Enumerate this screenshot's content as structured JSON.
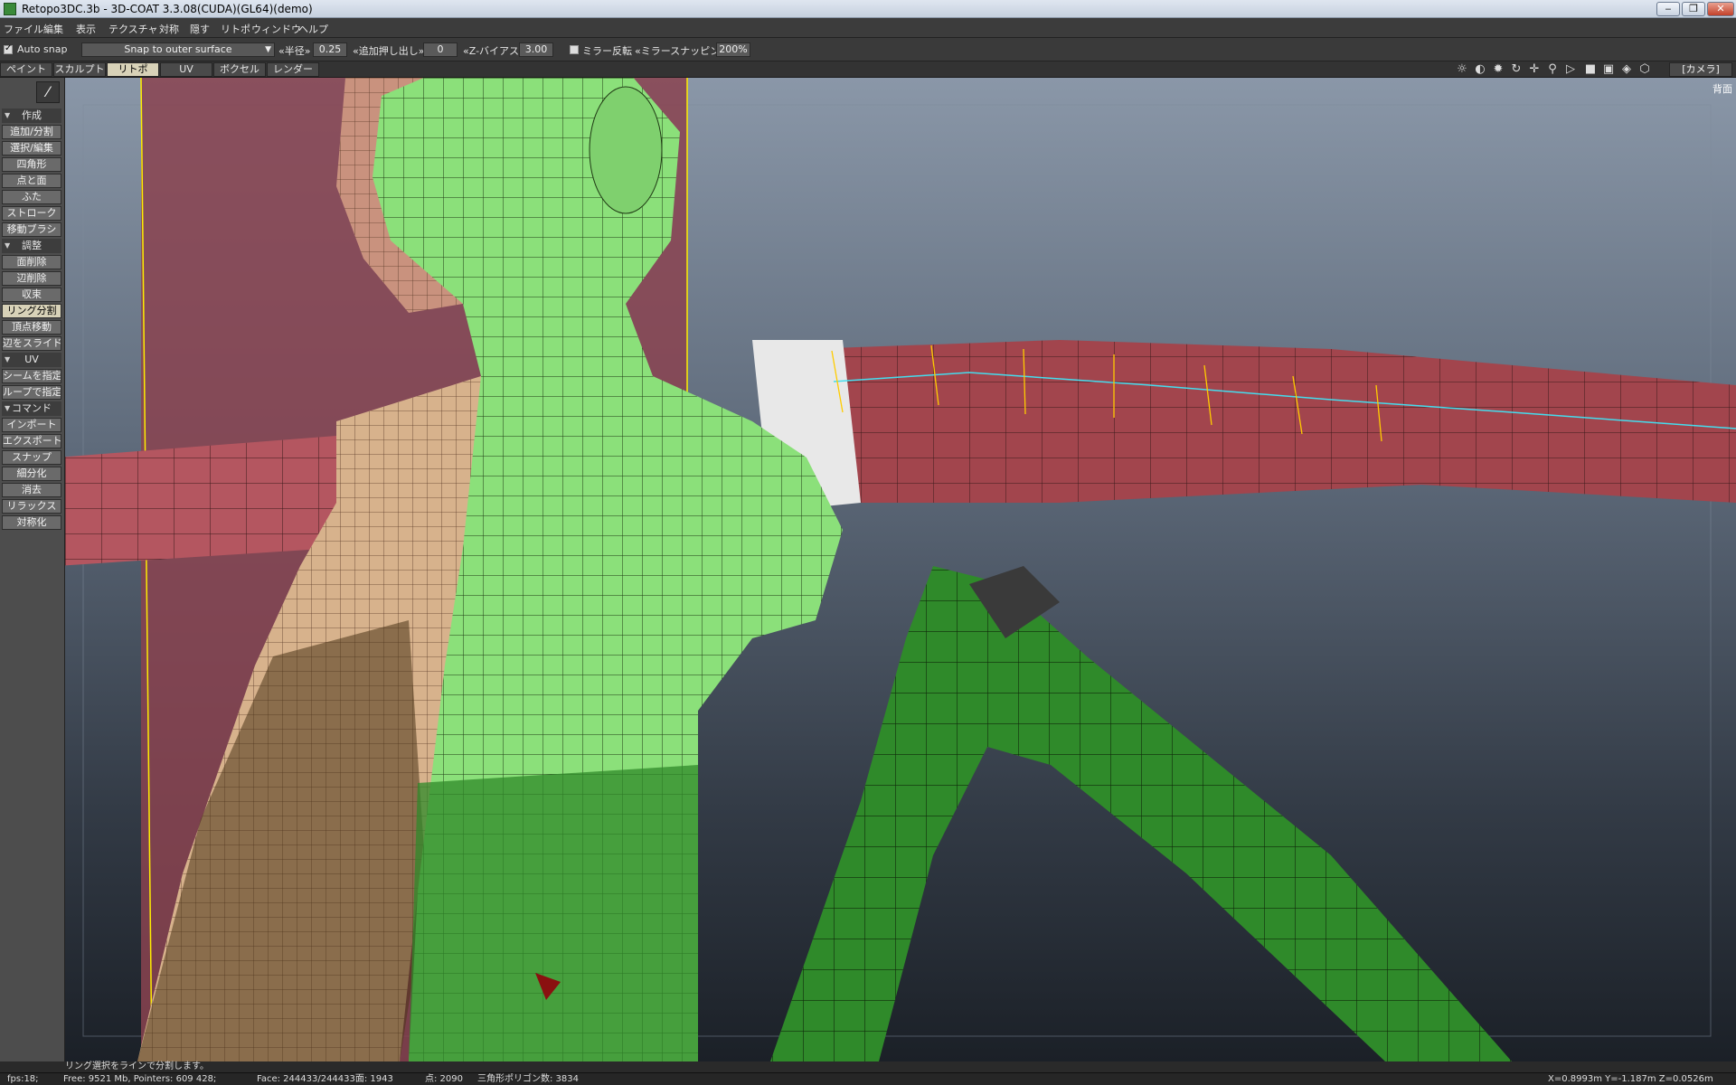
{
  "window": {
    "title": "Retopo3DC.3b - 3D-COAT 3.3.08(CUDA)(GL64)(demo)",
    "minimize": "‒",
    "maximize": "❐",
    "close": "✕"
  },
  "menu": [
    "ファイル",
    "編集",
    "表示",
    "テクスチャ",
    "対称",
    "隠す",
    "リトポ",
    "ウィンドウ",
    "ヘルプ"
  ],
  "toolbar": {
    "auto_snap_label": "Auto snap",
    "auto_snap_checked": true,
    "snap_mode": "Snap to outer surface",
    "radius_label": "«半径»",
    "radius_value": "0.25",
    "extrude_label": "«追加押し出し»",
    "extrude_value": "0",
    "zbias_label": "«Z-バイアス»",
    "zbias_value": "3.00",
    "mirror_label": "ミラー反転",
    "mirror_checked": false,
    "mirror_snap_label": "«ミラースナッピング»",
    "mirror_snap_value": "200%"
  },
  "rooms": {
    "tabs": [
      "ペイント",
      "スカルプト",
      "リトポ",
      "UV",
      "ボクセル",
      "レンダー"
    ],
    "active": "リトポ",
    "camera_label": "[カメラ]"
  },
  "viewport_icons": [
    "sun-icon",
    "contrast-icon",
    "light-icon",
    "rotate-icon",
    "move-icon",
    "zoom-icon",
    "play-icon",
    "square-icon",
    "frame-icon",
    "target-icon",
    "cube-icon"
  ],
  "panel": {
    "sections": [
      {
        "title": "作成",
        "items": [
          "追加/分割",
          "選択/編集",
          "四角形",
          "点と面",
          "ふた",
          "ストローク",
          "移動ブラシ"
        ]
      },
      {
        "title": "調整",
        "items": [
          "面削除",
          "辺削除",
          "収束",
          "リング分割",
          "頂点移動",
          "辺をスライド"
        ]
      },
      {
        "title": "UV",
        "items": [
          "シームを指定",
          "ループで指定"
        ]
      },
      {
        "title": "コマンド",
        "items": [
          "インポート",
          "エクスポート",
          "スナップ",
          "細分化",
          "消去",
          "リラックス",
          "対称化"
        ]
      }
    ],
    "active_item": "リング分割"
  },
  "viewport": {
    "view_label": "背面"
  },
  "status": {
    "hint": "リング選択をラインで分割します。",
    "fps": "fps:18;",
    "memory": "Free: 9521 Mb, Pointers: 609 428;",
    "faces": "Face: 244433/244433面: 1943",
    "points": "点: 2090",
    "tri_polys": "三角形ポリゴン数: 3834",
    "coords": "X=0.8993m  Y=-1.187m  Z=0.0526m"
  },
  "colors": {
    "mesh_green": "#8be07a",
    "mesh_dark_green": "#2f8a2a",
    "mesh_red": "#b85a62",
    "mesh_skin": "#d9b38f",
    "guide_yellow": "#ffee00",
    "ring_cyan": "#44ddee",
    "active_tab": "#d8d2b8"
  }
}
